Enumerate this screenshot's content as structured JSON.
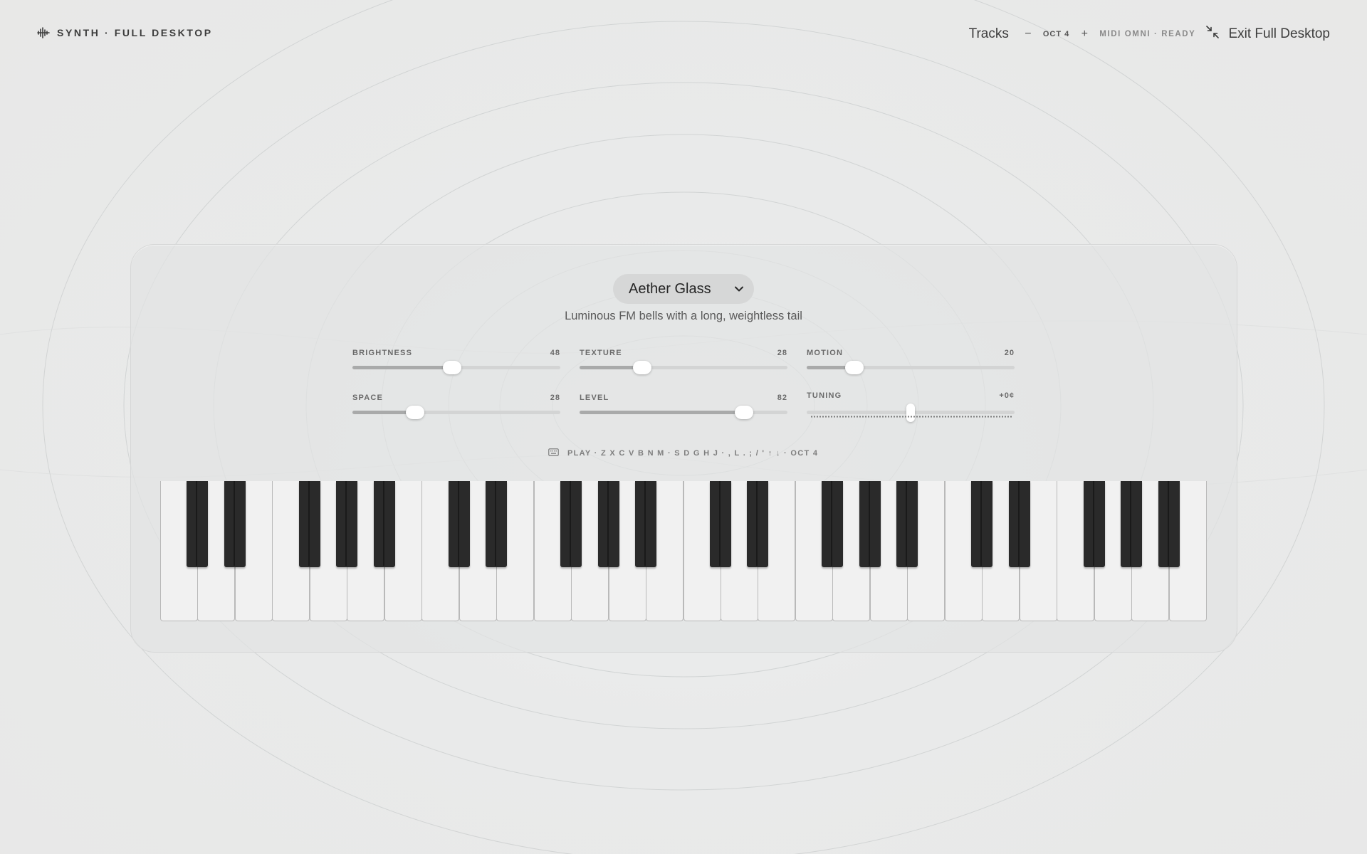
{
  "app": {
    "brand": "SYNTH · FULL DESKTOP"
  },
  "header": {
    "tracks_label": "Tracks",
    "octave_down": "−",
    "octave_label": "OCT 4",
    "octave_up": "+",
    "midi_status": "MIDI OMNI · READY",
    "exit_label": "Exit Full Desktop"
  },
  "preset": {
    "name": "Aether Glass",
    "description": "Luminous FM bells with a long, weightless tail"
  },
  "controls": [
    {
      "id": "brightness",
      "label": "BRIGHTNESS",
      "value": "48",
      "level": 0.48
    },
    {
      "id": "texture",
      "label": "TEXTURE",
      "value": "28",
      "level": 0.3
    },
    {
      "id": "motion",
      "label": "MOTION",
      "value": "20",
      "level": 0.23
    },
    {
      "id": "space",
      "label": "SPACE",
      "value": "28",
      "level": 0.3
    },
    {
      "id": "level",
      "label": "LEVEL",
      "value": "82",
      "level": 0.79
    },
    {
      "id": "tuning",
      "label": "TUNING",
      "value": "+0¢",
      "level": 0.5
    }
  ],
  "keyboard_hint": "PLAY · Z X C V B N M · S D G H J · , L . ; / ' ↑ ↓ · OCT 4",
  "keyboard": {
    "white_keys": 28,
    "black_pattern": [
      1,
      1,
      0,
      1,
      1,
      1,
      0
    ]
  },
  "colors": {
    "background": "#e9e9e8",
    "accent_dark": "#2a2a2a",
    "white_key": "#f1f1f1"
  },
  "icons": {
    "brand": "waveform-icon",
    "exit": "collapse-arrows-icon",
    "preset": "chevron-down-icon",
    "hint": "keyboard-icon"
  }
}
